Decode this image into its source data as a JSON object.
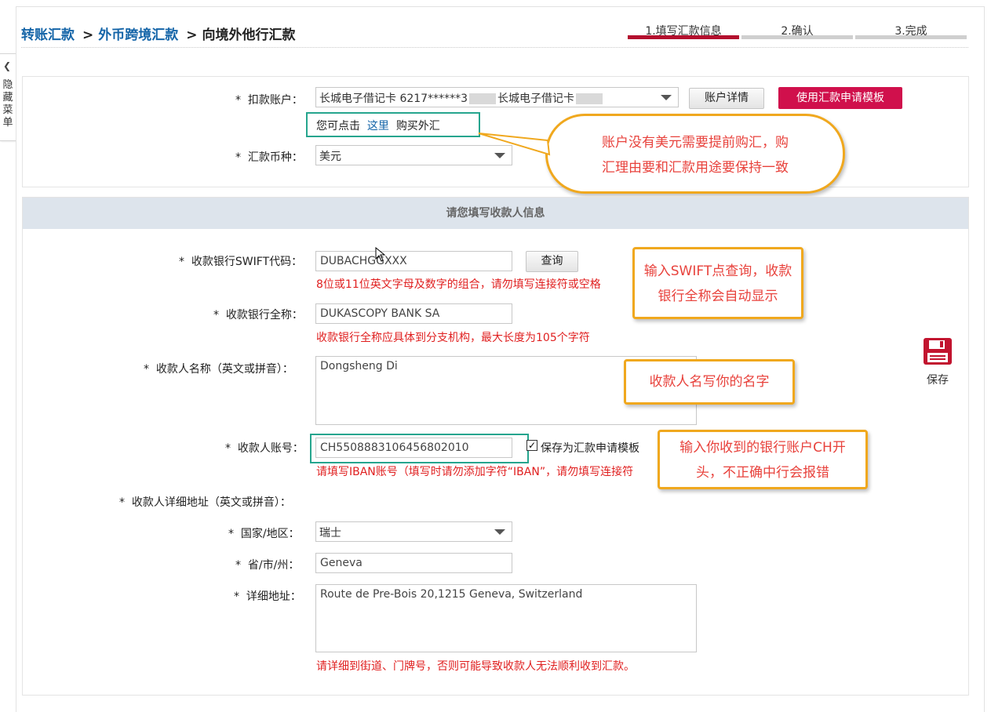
{
  "sidebar": {
    "collapse_icon": "chevron-left-icon",
    "label": "隐藏菜单"
  },
  "breadcrumb": {
    "item1": "转账汇款",
    "item2": "外币跨境汇款",
    "current": "向境外他行汇款",
    "sep": ">"
  },
  "steps": [
    {
      "label": "1.填写汇款信息",
      "active": true
    },
    {
      "label": "2.确认",
      "active": false
    },
    {
      "label": "3.完成",
      "active": false
    }
  ],
  "account": {
    "label": "扣款账户：",
    "value_a": "长城电子借记卡 6217******3",
    "value_b": "长城电子借记卡",
    "detail_button": "账户详情",
    "template_button": "使用汇款申请模板",
    "buy_prefix": "您可点击",
    "buy_link": "这里",
    "buy_suffix": "购买外汇"
  },
  "currency": {
    "label": "汇款币种：",
    "value": "美元"
  },
  "section_title": "请您填写收款人信息",
  "swift": {
    "label": "收款银行SWIFT代码：",
    "value": "DUBACHGGXXX",
    "query_button": "查询",
    "hint": "8位或11位英文字母及数字的组合，请勿填写连接符或空格"
  },
  "bank_name": {
    "label": "收款银行全称：",
    "value": "DUKASCOPY BANK SA",
    "hint": "收款银行全称应具体到分支机构，最大长度为105个字符"
  },
  "payee_name": {
    "label": "收款人名称（英文或拼音）：",
    "value": "Dongsheng Di"
  },
  "payee_account": {
    "label": "收款人账号：",
    "value": "CH5508883106456802010",
    "save_template_label": "保存为汇款申请模板",
    "save_template_checked": "✓",
    "hint": "请填写IBAN账号（填写时请勿添加字符“IBAN”，请勿填写连接符"
  },
  "address": {
    "label": "收款人详细地址（英文或拼音）：",
    "country_label": "国家/地区：",
    "country_value": "瑞士",
    "province_label": "省/市/州：",
    "province_value": "Geneva",
    "detail_label": "详细地址：",
    "detail_value": "Route de Pre-Bois 20,1215 Geneva, Switzerland",
    "hint": "请详细到街道、门牌号，否则可能导致收款人无法顺利收到汇款。"
  },
  "required_mark": "*",
  "save": {
    "icon": "floppy-disk-icon",
    "label": "保存"
  },
  "callouts": {
    "c1_line1": "账户没有美元需要提前购汇，购",
    "c1_line2": "汇理由要和汇款用途要保持一致",
    "c2_line1": "输入SWIFT点查询，收款",
    "c2_line2": "银行全称会自动显示",
    "c3": "收款人名写你的名字",
    "c4_line1": "输入你收到的银行账户CH开",
    "c4_line2": "头，不正确中行会报错"
  },
  "colors": {
    "brand_red": "#d0104c",
    "link_blue": "#1565a8",
    "hint_red": "#e02020",
    "callout_orange": "#f0a81e",
    "teal": "#26a58e"
  }
}
